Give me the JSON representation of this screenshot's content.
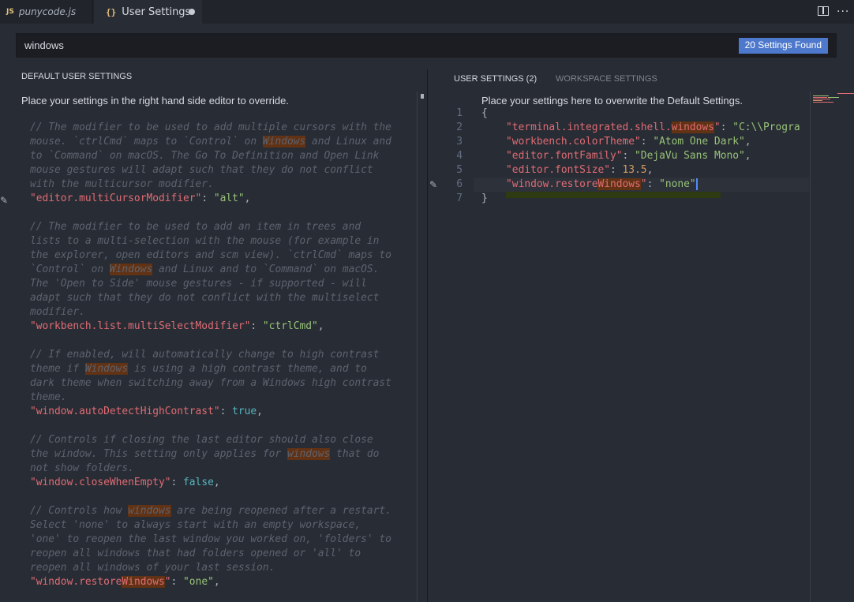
{
  "tabs": [
    {
      "badge": "JS",
      "label": "punycode.js"
    },
    {
      "badge": "{}",
      "label": "User Settings"
    }
  ],
  "search": {
    "value": "windows",
    "results_badge": "20 Settings Found"
  },
  "left_pane": {
    "header": "DEFAULT USER SETTINGS",
    "intro": "Place your settings in the right hand side editor to override."
  },
  "right_pane": {
    "tab_user": "USER SETTINGS (2)",
    "tab_workspace": "WORKSPACE SETTINGS",
    "intro": "Place your settings here to overwrite the Default Settings.",
    "line_numbers": [
      "1",
      "2",
      "3",
      "4",
      "5",
      "6",
      "7"
    ]
  },
  "default_settings_lines": [
    [
      {
        "c": "cmt",
        "t": "// The modifier to be used to add multiple cursors with the"
      }
    ],
    [
      {
        "c": "cmt",
        "t": "mouse. `ctrlCmd` maps to `Control` on "
      },
      {
        "c": "cmt hl",
        "t": "Windows"
      },
      {
        "c": "cmt",
        "t": " and Linux and"
      }
    ],
    [
      {
        "c": "cmt",
        "t": "to `Command` on macOS. The Go To Definition and Open Link"
      }
    ],
    [
      {
        "c": "cmt",
        "t": "mouse gestures will adapt such that they do not conflict"
      }
    ],
    [
      {
        "c": "cmt",
        "t": "with the multicursor modifier."
      }
    ],
    [
      {
        "c": "key",
        "t": "\"editor.multiCursorModifier\""
      },
      {
        "c": "punc",
        "t": ": "
      },
      {
        "c": "str",
        "t": "\"alt\""
      },
      {
        "c": "punc",
        "t": ","
      }
    ],
    [],
    [
      {
        "c": "cmt",
        "t": "// The modifier to be used to add an item in trees and"
      }
    ],
    [
      {
        "c": "cmt",
        "t": "lists to a multi-selection with the mouse (for example in"
      }
    ],
    [
      {
        "c": "cmt",
        "t": "the explorer, open editors and scm view). `ctrlCmd` maps to"
      }
    ],
    [
      {
        "c": "cmt",
        "t": "`Control` on "
      },
      {
        "c": "cmt hl",
        "t": "Windows"
      },
      {
        "c": "cmt",
        "t": " and Linux and to `Command` on macOS."
      }
    ],
    [
      {
        "c": "cmt",
        "t": "The 'Open to Side' mouse gestures - if supported - will"
      }
    ],
    [
      {
        "c": "cmt",
        "t": "adapt such that they do not conflict with the multiselect"
      }
    ],
    [
      {
        "c": "cmt",
        "t": "modifier."
      }
    ],
    [
      {
        "c": "key",
        "t": "\"workbench.list.multiSelectModifier\""
      },
      {
        "c": "punc",
        "t": ": "
      },
      {
        "c": "str",
        "t": "\"ctrlCmd\""
      },
      {
        "c": "punc",
        "t": ","
      }
    ],
    [],
    [
      {
        "c": "cmt",
        "t": "// If enabled, will automatically change to high contrast"
      }
    ],
    [
      {
        "c": "cmt",
        "t": "theme if "
      },
      {
        "c": "cmt hl",
        "t": "Windows"
      },
      {
        "c": "cmt",
        "t": " is using a high contrast theme, and to"
      }
    ],
    [
      {
        "c": "cmt",
        "t": "dark theme when switching away from a Windows high contrast"
      }
    ],
    [
      {
        "c": "cmt",
        "t": "theme."
      }
    ],
    [
      {
        "c": "key",
        "t": "\"window.autoDetectHighContrast\""
      },
      {
        "c": "punc",
        "t": ": "
      },
      {
        "c": "bool",
        "t": "true"
      },
      {
        "c": "punc",
        "t": ","
      }
    ],
    [],
    [
      {
        "c": "cmt",
        "t": "// Controls if closing the last editor should also close"
      }
    ],
    [
      {
        "c": "cmt",
        "t": "the window. This setting only applies for "
      },
      {
        "c": "cmt hl",
        "t": "windows"
      },
      {
        "c": "cmt",
        "t": " that do"
      }
    ],
    [
      {
        "c": "cmt",
        "t": "not show folders."
      }
    ],
    [
      {
        "c": "key",
        "t": "\"window.closeWhenEmpty\""
      },
      {
        "c": "punc",
        "t": ": "
      },
      {
        "c": "bool",
        "t": "false"
      },
      {
        "c": "punc",
        "t": ","
      }
    ],
    [],
    [
      {
        "c": "cmt",
        "t": "// Controls how "
      },
      {
        "c": "cmt hl",
        "t": "windows"
      },
      {
        "c": "cmt",
        "t": " are being reopened after a restart."
      }
    ],
    [
      {
        "c": "cmt",
        "t": "Select 'none' to always start with an empty workspace,"
      }
    ],
    [
      {
        "c": "cmt",
        "t": "'one' to reopen the last window you worked on, 'folders' to"
      }
    ],
    [
      {
        "c": "cmt",
        "t": "reopen all windows that had folders opened or 'all' to"
      }
    ],
    [
      {
        "c": "cmt",
        "t": "reopen all windows of your last session."
      }
    ],
    [
      {
        "c": "key",
        "t": "\"window.restore"
      },
      {
        "c": "key hl",
        "t": "Windows"
      },
      {
        "c": "key",
        "t": "\""
      },
      {
        "c": "punc",
        "t": ": "
      },
      {
        "c": "str",
        "t": "\"one\""
      },
      {
        "c": "punc",
        "t": ","
      }
    ]
  ],
  "user_settings_lines": [
    [
      {
        "c": "punc",
        "t": "{"
      }
    ],
    [
      {
        "c": "punc",
        "t": "    "
      },
      {
        "c": "key",
        "t": "\"terminal.integrated.shell."
      },
      {
        "c": "key hl",
        "t": "windows"
      },
      {
        "c": "key",
        "t": "\""
      },
      {
        "c": "punc",
        "t": ": "
      },
      {
        "c": "str",
        "t": "\"C:\\\\Progra"
      }
    ],
    [
      {
        "c": "punc",
        "t": "    "
      },
      {
        "c": "key",
        "t": "\"workbench.colorTheme\""
      },
      {
        "c": "punc",
        "t": ": "
      },
      {
        "c": "str",
        "t": "\"Atom One Dark\""
      },
      {
        "c": "punc",
        "t": ","
      }
    ],
    [
      {
        "c": "punc",
        "t": "    "
      },
      {
        "c": "key",
        "t": "\"editor.fontFamily\""
      },
      {
        "c": "punc",
        "t": ": "
      },
      {
        "c": "str",
        "t": "\"DejaVu Sans Mono\""
      },
      {
        "c": "punc",
        "t": ","
      }
    ],
    [
      {
        "c": "punc",
        "t": "    "
      },
      {
        "c": "key",
        "t": "\"editor.fontSize\""
      },
      {
        "c": "punc",
        "t": ": "
      },
      {
        "c": "num",
        "t": "13.5"
      },
      {
        "c": "punc",
        "t": ","
      }
    ],
    [
      {
        "c": "punc",
        "t": "    "
      },
      {
        "c": "key",
        "t": "\"window.restore"
      },
      {
        "c": "key hl",
        "t": "Windows"
      },
      {
        "c": "key",
        "t": "\""
      },
      {
        "c": "punc",
        "t": ": "
      },
      {
        "c": "str",
        "t": "\"none\""
      }
    ],
    [
      {
        "c": "punc",
        "t": "}"
      }
    ]
  ],
  "colors": {
    "editor_bg": "#282c34",
    "tabbar_bg": "#21252b",
    "badge_blue": "#4d78cc",
    "match_highlight": "#613214",
    "key": "#e06c75",
    "string": "#98c379",
    "comment": "#5c6370",
    "number": "#d19a66"
  },
  "icons": [
    "split-editor-icon",
    "more-actions-icon",
    "edit-pencil-icon"
  ]
}
